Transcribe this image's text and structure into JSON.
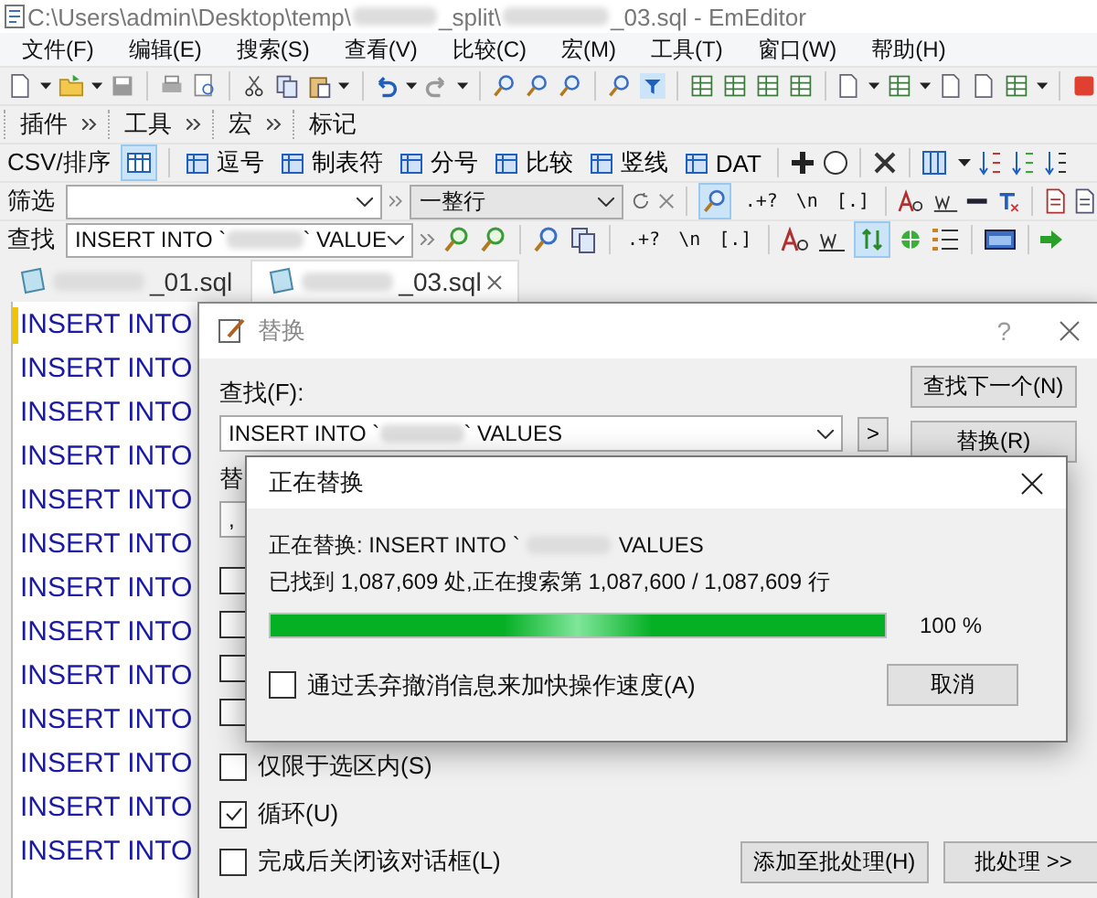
{
  "window": {
    "title_start": "C:\\Users\\admin\\Desktop\\temp\\",
    "title_middle": "_split\\",
    "title_end": "_03.sql - EmEditor"
  },
  "menu": [
    "文件(F)",
    "编辑(E)",
    "搜索(S)",
    "查看(V)",
    "比较(C)",
    "宏(M)",
    "工具(T)",
    "窗口(W)",
    "帮助(H)"
  ],
  "toolbar_labels": [
    "插件",
    "工具",
    "宏",
    "标记"
  ],
  "csv_bar": {
    "label": "CSV/排序",
    "items": [
      "逗号",
      "制表符",
      "分号",
      "比较",
      "竖线",
      "DAT"
    ]
  },
  "filter_bar": {
    "label": "筛选",
    "scope": "一整行",
    "options": [
      ".+?",
      "\\n",
      "[.]"
    ]
  },
  "find_bar": {
    "label": "查找",
    "value_start": "INSERT INTO `",
    "value_end": "` VALUE",
    "options": [
      ".+?",
      "\\n",
      "[.]"
    ]
  },
  "tabs": [
    {
      "label": "_01.sql",
      "selected": false
    },
    {
      "label": "_03.sql",
      "selected": true
    }
  ],
  "editor": {
    "lines": [
      "INSERT INTO",
      "INSERT INTO",
      "INSERT INTO",
      "INSERT INTO",
      "INSERT INTO",
      "INSERT INTO",
      "INSERT INTO",
      "INSERT INTO",
      "INSERT INTO",
      "INSERT INTO",
      "INSERT INTO",
      "INSERT INTO",
      "INSERT INTO"
    ]
  },
  "replace_dialog": {
    "title": "替换",
    "help": "?",
    "find_label": "查找(F):",
    "find_value_start": "INSERT INTO `",
    "find_value_end": "` VALUES",
    "expand": ">",
    "buttons": [
      "查找下一个(N)",
      "替换(R)"
    ],
    "replace_label": "替",
    "replace_value": ",",
    "covered_checkboxes": [
      {
        "checked": false
      },
      {
        "checked": false
      },
      {
        "checked": false
      },
      {
        "checked": false
      }
    ],
    "options": [
      {
        "label": "仅限于选区内(S)",
        "checked": false
      },
      {
        "label": "循环(U)",
        "checked": true
      },
      {
        "label": "完成后关闭该对话框(L)",
        "checked": false
      }
    ],
    "bottom_buttons": [
      "添加至批处理(H)",
      "批处理 >>"
    ]
  },
  "progress_dialog": {
    "title": "正在替换",
    "status_start": "正在替换: INSERT INTO `",
    "status_end": "VALUES",
    "found": "已找到 1,087,609 处,正在搜索第 1,087,600 / 1,087,609 行",
    "level": 1,
    "percent": "100 %",
    "option": {
      "label": "通过丢弃撤消信息来加快操作速度(A)",
      "checked": false
    },
    "cancel": "取消"
  }
}
